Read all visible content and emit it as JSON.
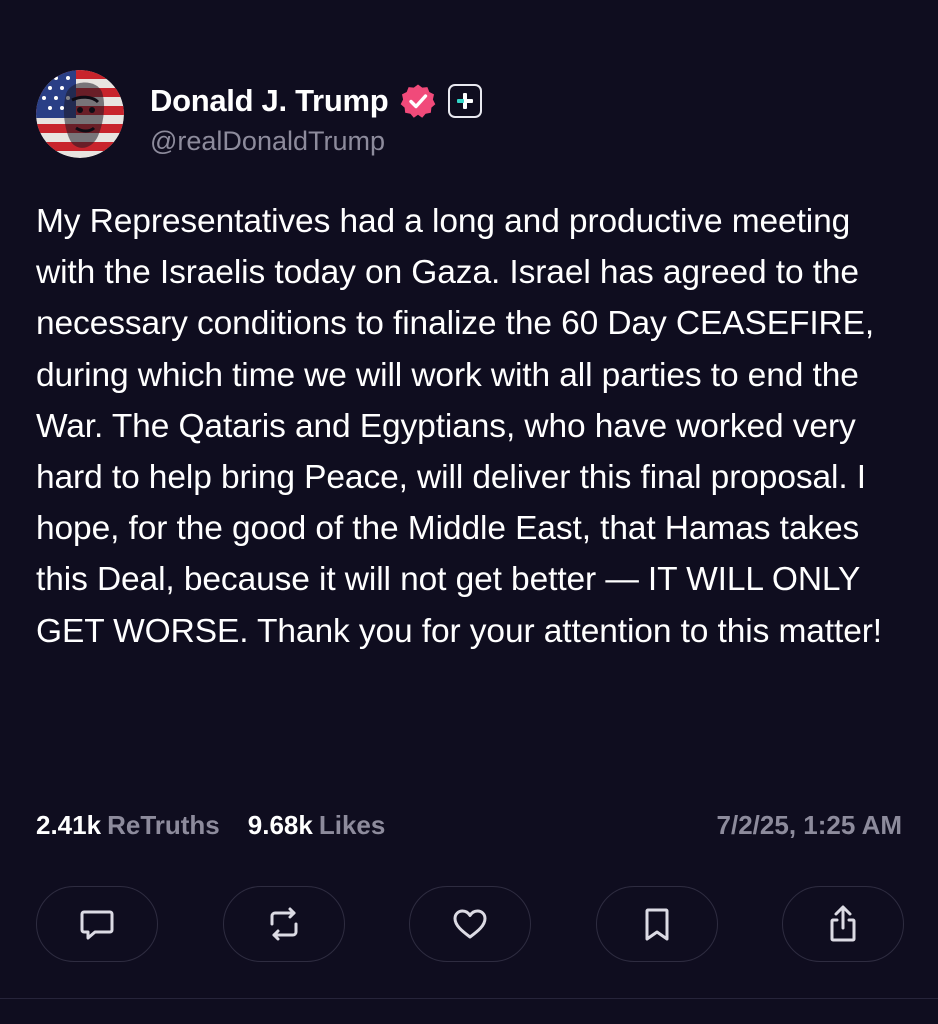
{
  "author": {
    "display_name": "Donald J. Trump",
    "handle": "@realDonaldTrump",
    "avatar_icon": "american-flag-portrait-avatar",
    "verified_icon": "verified-badge-icon",
    "verified_color": "#f14a7a",
    "follow_icon": "plus-icon",
    "follow_accent": "#34d6c8"
  },
  "post": {
    "text": "My Representatives had a long and productive meeting with the Israelis today on Gaza. Israel has agreed to the necessary conditions to finalize the 60 Day CEASEFIRE, during which time we will work with all parties to end the War. The Qataris and Egyptians, who have worked very hard to help bring Peace, will deliver this final proposal. I hope, for the good of the Middle East, that Hamas takes this Deal, because it will not get better — IT WILL ONLY GET WORSE. Thank you for your attention to this matter!"
  },
  "stats": {
    "retruths_count": "2.41k",
    "retruths_label": "ReTruths",
    "likes_count": "9.68k",
    "likes_label": "Likes",
    "timestamp": "7/2/25, 1:25 AM"
  },
  "actions": [
    {
      "name": "reply",
      "icon": "comment-icon"
    },
    {
      "name": "retruth",
      "icon": "retruth-icon"
    },
    {
      "name": "like",
      "icon": "heart-icon"
    },
    {
      "name": "bookmark",
      "icon": "bookmark-icon"
    },
    {
      "name": "share",
      "icon": "share-icon"
    }
  ],
  "colors": {
    "background": "#0f0d1f",
    "text": "#ffffff",
    "muted": "#8d8b9c",
    "button_border": "#2e2c40"
  }
}
